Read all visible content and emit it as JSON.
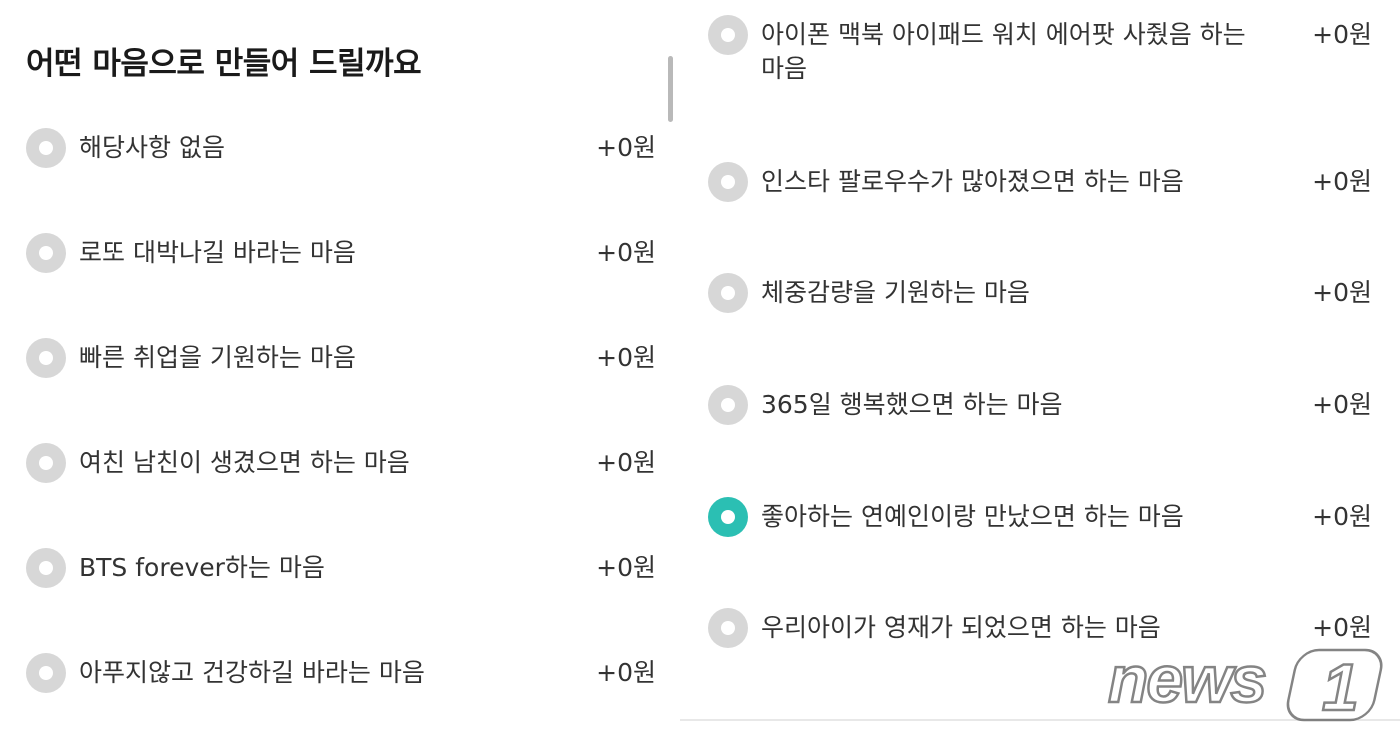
{
  "title": "어떤 마음으로 만들어 드릴까요",
  "left_options": [
    {
      "label": "해당사항 없음",
      "price": "+0원",
      "selected": false
    },
    {
      "label": "로또 대박나길 바라는 마음",
      "price": "+0원",
      "selected": false
    },
    {
      "label": "빠른 취업을 기원하는 마음",
      "price": "+0원",
      "selected": false
    },
    {
      "label": "여친 남친이 생겼으면 하는 마음",
      "price": "+0원",
      "selected": false
    },
    {
      "label": "BTS forever하는 마음",
      "price": "+0원",
      "selected": false
    },
    {
      "label": "아푸지않고 건강하길 바라는 마음",
      "price": "+0원",
      "selected": false
    }
  ],
  "right_options": [
    {
      "label": "아이폰 맥북 아이패드 워치 에어팟 사줬음 하는 마음",
      "price": "+0원",
      "selected": false
    },
    {
      "label": "인스타 팔로우수가 많아졌으면 하는 마음",
      "price": "+0원",
      "selected": false
    },
    {
      "label": "체중감량을 기원하는 마음",
      "price": "+0원",
      "selected": false
    },
    {
      "label": "365일 행복했으면 하는 마음",
      "price": "+0원",
      "selected": false
    },
    {
      "label": "좋아하는 연예인이랑 만났으면 하는 마음",
      "price": "+0원",
      "selected": true
    },
    {
      "label": "우리아이가 영재가 되었으면 하는 마음",
      "price": "+0원",
      "selected": false
    }
  ],
  "watermark": {
    "text": "news1"
  },
  "colors": {
    "selected": "#2bbfb3",
    "unselected": "#d7d7d7"
  }
}
